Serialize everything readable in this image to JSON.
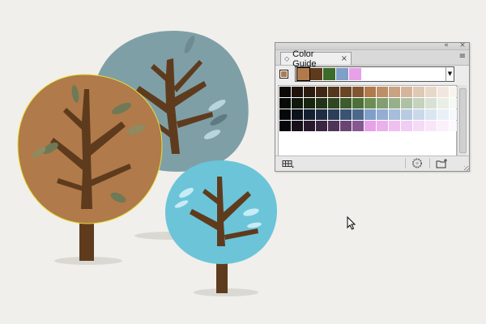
{
  "scene": {
    "trees": [
      {
        "name": "brown-tree",
        "foliage": "#b07a4b",
        "leaves": "#6d7a55",
        "trunk": "#5f3b1d",
        "selected": true
      },
      {
        "name": "grey-blue-tree",
        "foliage": "#7f9fa6",
        "leaves": "#b9d5dc",
        "trunk": "#5f3b1d",
        "selected": false
      },
      {
        "name": "light-blue-tree",
        "foliage": "#6cc4d8",
        "leaves": "#c6ecf5",
        "trunk": "#5f3b1d",
        "selected": false
      }
    ],
    "selection_color": "#e6e234",
    "background": "#f0efeb",
    "shadow": "#d9d8d2"
  },
  "panel": {
    "title": "Color Guide",
    "tab_icon": "diamond-icon",
    "close_tab_glyph": "×",
    "menu_glyph": "≡",
    "collapse_glyph": "«",
    "close_glyph": "×",
    "base_color": "#b07a4b",
    "harmony_colors": [
      "#b07a4b",
      "#5f3b1d",
      "#3c6b2a",
      "#7f9fc8",
      "#e7a1e8"
    ],
    "dropdown_glyph": "▼",
    "variation_columns": [
      [
        "#0b0806",
        "#070a05",
        "#06080a",
        "#08060a"
      ],
      [
        "#1f140b",
        "#0f180b",
        "#0c121a",
        "#170f19"
      ],
      [
        "#2d1d10",
        "#172410",
        "#132032",
        "#281a2c"
      ],
      [
        "#3f2916",
        "#223418",
        "#1e2d44",
        "#3a2640"
      ],
      [
        "#54371d",
        "#2f4621",
        "#2b3f5a",
        "#503457"
      ],
      [
        "#6a4626",
        "#3d5b2b",
        "#3a5372",
        "#6a4573"
      ],
      [
        "#825632",
        "#4c7037",
        "#4b688a",
        "#86588f"
      ],
      [
        "#b07a4b",
        "#6c8e55",
        "#7f9fc8",
        "#e7a1e8"
      ],
      [
        "#bd8f66",
        "#839f70",
        "#93aed2",
        "#ebb0ec"
      ],
      [
        "#c9a281",
        "#98b08a",
        "#a6bddb",
        "#efbff0"
      ],
      [
        "#d4b59b",
        "#aec1a4",
        "#b8cbe3",
        "#f2cdf3"
      ],
      [
        "#dfc8b4",
        "#c4d2be",
        "#cad9ea",
        "#f5dbf6"
      ],
      [
        "#e8d8ca",
        "#d8e2d4",
        "#dbe5f1",
        "#f8e6f8"
      ],
      [
        "#f1e7de",
        "#e9efe6",
        "#e9f0f7",
        "#fbf0fb"
      ],
      [
        "#f9f3ee",
        "#f5f8f3",
        "#f5f8fc",
        "#fdf8fd"
      ]
    ],
    "bottom_icons": [
      "limit-to-swatch-library-icon",
      "edit-colors-icon",
      "save-to-swatches-icon"
    ]
  },
  "cursor": "arrow-cursor"
}
